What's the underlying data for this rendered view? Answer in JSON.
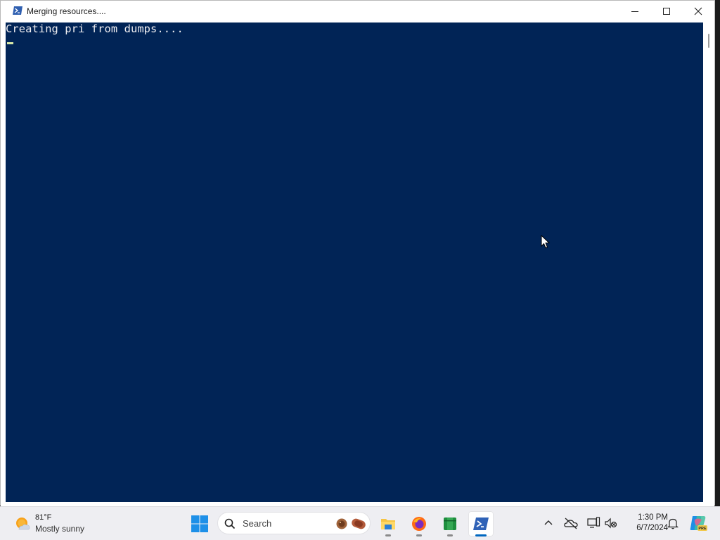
{
  "window": {
    "title": "Merging resources....",
    "icon": "powershell-icon",
    "buttons": {
      "minimize": "minimize-icon",
      "maximize": "maximize-icon",
      "close": "close-icon"
    }
  },
  "console": {
    "lines": [
      "Creating pri from dumps...."
    ],
    "background": "#012456",
    "foreground": "#eeedf0"
  },
  "taskbar": {
    "weather": {
      "temp": "81°F",
      "condition": "Mostly sunny",
      "icon": "partly-sunny-icon"
    },
    "search": {
      "placeholder": "Search"
    },
    "apps": [
      {
        "name": "start-icon"
      },
      {
        "name": "file-explorer-icon"
      },
      {
        "name": "firefox-icon"
      },
      {
        "name": "green-app-icon"
      },
      {
        "name": "powershell-icon",
        "active": true
      }
    ],
    "tray": {
      "icons": [
        "chevron-up-icon",
        "onedrive-icon",
        "network-icon",
        "volume-muted-icon",
        "notification-bell-icon",
        "copilot-icon"
      ],
      "time": "1:30 PM",
      "date": "6/7/2024"
    }
  }
}
